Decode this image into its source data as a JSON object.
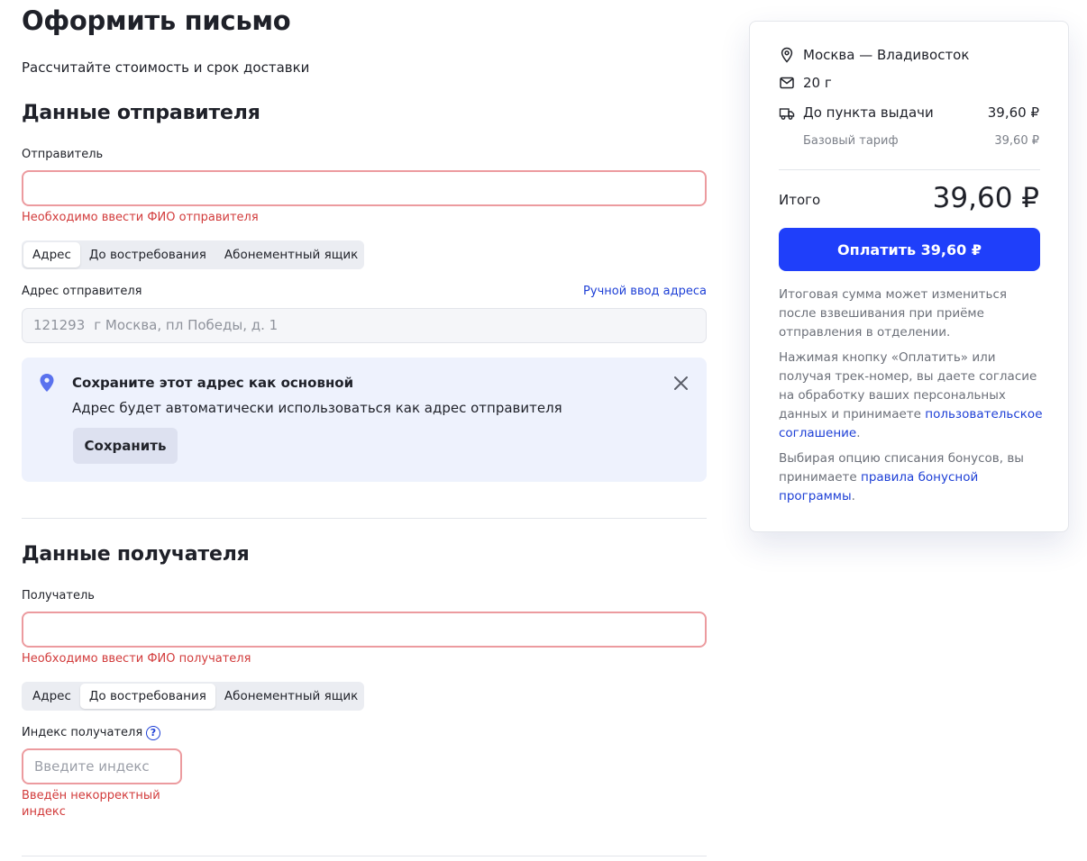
{
  "page": {
    "title": "Оформить письмо",
    "subtitle": "Рассчитайте стоимость и срок доставки"
  },
  "sender": {
    "section_title": "Данные отправителя",
    "name_label": "Отправитель",
    "name_value": "",
    "name_error": "Необходимо ввести ФИО отправителя",
    "tabs": [
      "Адрес",
      "До востребования",
      "Абонементный ящик"
    ],
    "active_tab": "Адрес",
    "address_label": "Адрес отправителя",
    "manual_address_link": "Ручной ввод адреса",
    "address_index": "121293",
    "address_text": "г Москва, пл Победы, д. 1",
    "banner": {
      "title": "Сохраните этот адрес как основной",
      "text": "Адрес будет автоматически использоваться как адрес отправителя",
      "button": "Сохранить"
    }
  },
  "recipient": {
    "section_title": "Данные получателя",
    "name_label": "Получатель",
    "name_value": "",
    "name_error": "Необходимо ввести ФИО получателя",
    "tabs": [
      "Адрес",
      "До востребования",
      "Абонементный ящик"
    ],
    "active_tab": "До востребования",
    "index_label": "Индекс получателя",
    "index_help": "?",
    "index_placeholder": "Введите индекс",
    "index_error_line1": "Введён некорректный",
    "index_error_line2": "индекс"
  },
  "summary": {
    "route": "Москва — Владивосток",
    "weight": "20 г",
    "delivery_type": "До пункта выдачи",
    "delivery_price": "39,60 ₽",
    "tariff_label": "Базовый тариф",
    "tariff_price": "39,60 ₽",
    "total_label": "Итого",
    "total_value": "39,60 ₽",
    "pay_button": "Оплатить 39,60 ₽",
    "note1": "Итоговая сумма может измениться после взвешивания при приёме отправления в отделении.",
    "note2_text": "Нажимая кнопку «Оплатить» или получая трек-номер, вы даете согласие на обработку ваших персональных данных и принимаете",
    "note2_link": "пользовательское соглашение",
    "note2_end": ".",
    "note3_text": "Выбирая опцию списания бонусов, вы принимаете",
    "note3_link": "правила бонусной программы",
    "note3_end": "."
  },
  "colors": {
    "accent": "#1f3ffa",
    "link": "#1d3fd6",
    "error": "#d23b3b",
    "error_border": "#ec9b9f",
    "banner_bg": "#eef2fd"
  }
}
